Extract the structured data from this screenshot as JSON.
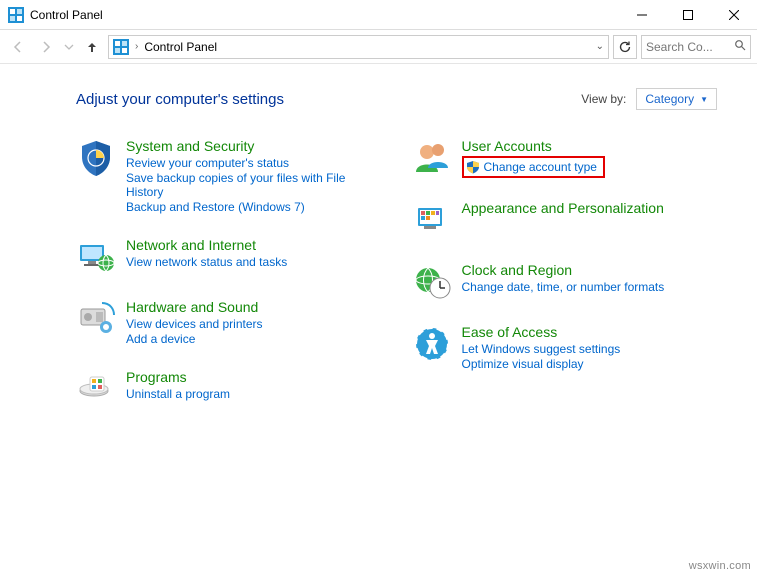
{
  "window": {
    "title": "Control Panel",
    "minimize_tip": "Minimize",
    "maximize_tip": "Maximize",
    "close_tip": "Close"
  },
  "nav": {
    "address_text": "Control Panel",
    "search_placeholder": "Search Co..."
  },
  "header": {
    "title": "Adjust your computer's settings",
    "viewby_label": "View by:",
    "viewby_value": "Category"
  },
  "left": {
    "c0": {
      "title": "System and Security",
      "l0": "Review your computer's status",
      "l1": "Save backup copies of your files with File History",
      "l2": "Backup and Restore (Windows 7)"
    },
    "c1": {
      "title": "Network and Internet",
      "l0": "View network status and tasks"
    },
    "c2": {
      "title": "Hardware and Sound",
      "l0": "View devices and printers",
      "l1": "Add a device"
    },
    "c3": {
      "title": "Programs",
      "l0": "Uninstall a program"
    }
  },
  "right": {
    "c0": {
      "title": "User Accounts",
      "l0": "Change account type"
    },
    "c1": {
      "title": "Appearance and Personalization"
    },
    "c2": {
      "title": "Clock and Region",
      "l0": "Change date, time, or number formats"
    },
    "c3": {
      "title": "Ease of Access",
      "l0": "Let Windows suggest settings",
      "l1": "Optimize visual display"
    }
  },
  "watermark": "wsxwin.com"
}
